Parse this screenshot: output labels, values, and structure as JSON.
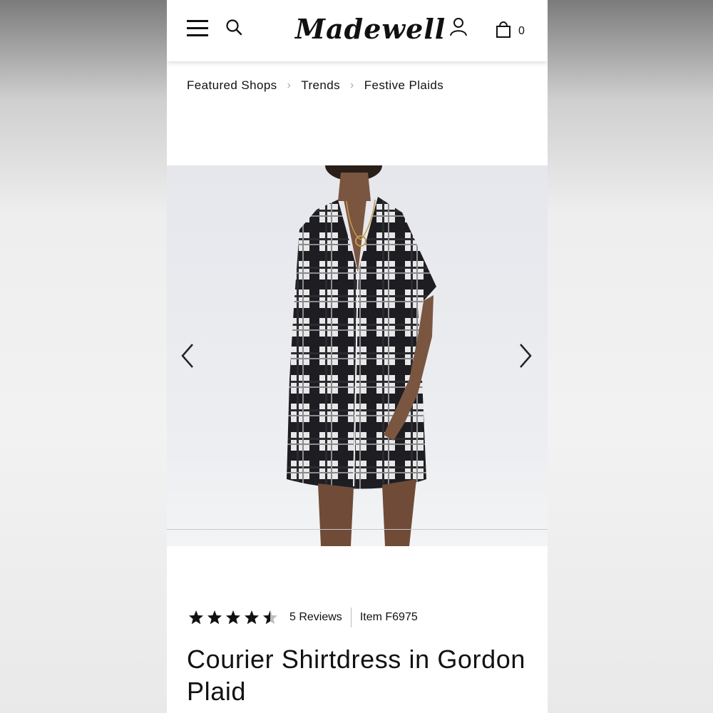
{
  "header": {
    "logo_text": "Madewell",
    "cart_count": "0",
    "icons": [
      "menu-icon",
      "search-icon",
      "account-icon",
      "shopping-bag-icon"
    ]
  },
  "breadcrumb": {
    "items": [
      "Featured Shops",
      "Trends",
      "Festive Plaids"
    ]
  },
  "product": {
    "rating": 4.5,
    "rating_max": 5,
    "reviews_label": "5 Reviews",
    "item_label": "Item F6975",
    "title": "Courier Shirtdress in Gordon Plaid"
  },
  "gallery": {
    "icons": [
      "chevron-left-icon",
      "chevron-right-icon"
    ]
  },
  "colors": {
    "text": "#111111",
    "background": "#ffffff",
    "star": "#111111",
    "star_empty": "#bdbdbd"
  }
}
